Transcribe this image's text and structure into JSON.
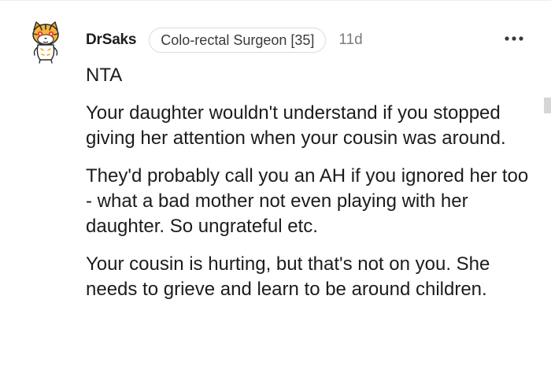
{
  "comment": {
    "username": "DrSaks",
    "flair": "Colo-rectal Surgeon [35]",
    "age": "11d",
    "more_icon": "more-horizontal-icon",
    "avatar_icon": "snoo-avatar-icon",
    "paragraphs": [
      "NTA",
      "Your daughter wouldn't understand if you stopped giving her attention when your cousin was around.",
      "They'd probably call you an AH if you ignored her too - what a bad mother not even playing with her daughter. So ungrateful etc.",
      "Your cousin is hurting, but that's not on you. She needs to grieve and learn to be around children."
    ]
  },
  "colors": {
    "text": "#1c1c1c",
    "meta": "#7c7c7c",
    "flair_border": "#dcdcdc",
    "avatar_accent": "#f5a623"
  }
}
